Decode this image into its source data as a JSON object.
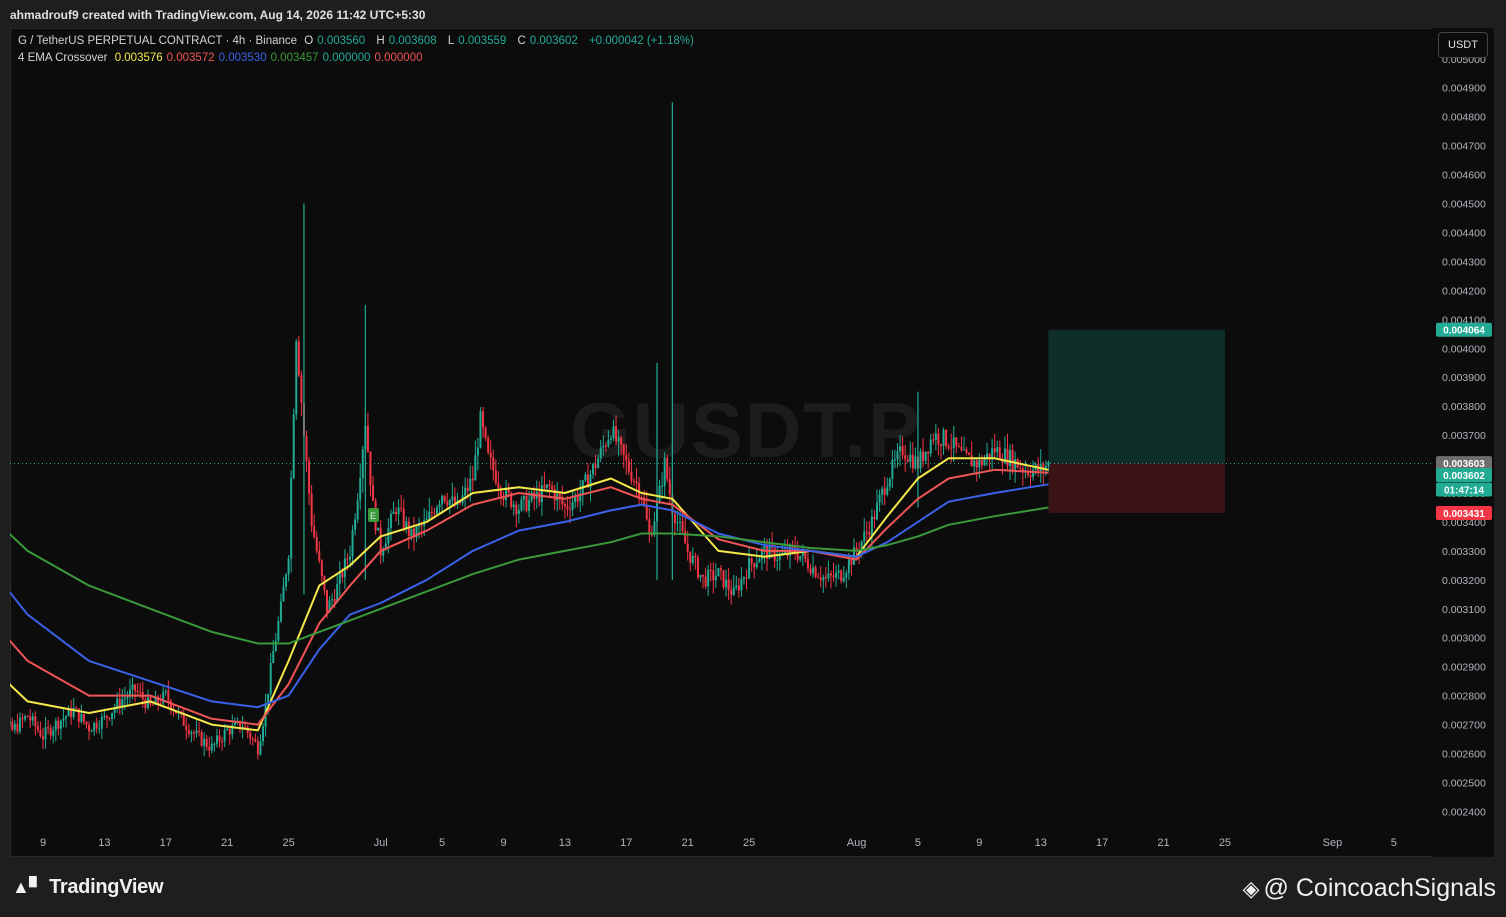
{
  "header": {
    "credit": "ahmadrouf9 created with TradingView.com, Aug 14, 2026 11:42 UTC+5:30"
  },
  "legend": {
    "symbol": "G / TetherUS PERPETUAL CONTRACT · 4h · Binance",
    "o_label": "O",
    "o": "0.003560",
    "h_label": "H",
    "h": "0.003608",
    "l_label": "L",
    "l": "0.003559",
    "c_label": "C",
    "c": "0.003602",
    "change": "+0.000042 (+1.18%)",
    "indicator": "4 EMA Crossover",
    "ema_values": [
      "0.003576",
      "0.003572",
      "0.003530",
      "0.003457",
      "0.000000",
      "0.000000"
    ],
    "ema_colors": [
      "#f5e94a",
      "#f05555",
      "#3a62e8",
      "#3a9a3a",
      "#22ab94",
      "#f05555"
    ]
  },
  "currency_button": "USDT",
  "watermark": "GUSDT.P",
  "footer": {
    "tv_logo": "TradingView",
    "brand": "@ CoincoachSignals"
  },
  "colors": {
    "up": "#22ab94",
    "down": "#f23645",
    "ema1": "#f5e94a",
    "ema2": "#f05555",
    "ema3": "#3a62e8",
    "ema4": "#3a9a3a",
    "target_zone": "#0f2e2a",
    "stop_zone": "#3a1414"
  },
  "chart_data": {
    "type": "candlestick",
    "timeframe": "4h",
    "x_ticks": [
      "9",
      "13",
      "17",
      "21",
      "25",
      "Jul",
      "5",
      "9",
      "13",
      "17",
      "21",
      "25",
      "Aug",
      "5",
      "9",
      "13",
      "17",
      "21",
      "25",
      "Sep",
      "5"
    ],
    "x_tick_days": [
      9,
      13,
      17,
      21,
      25,
      31,
      35,
      39,
      43,
      47,
      51,
      55,
      62,
      66,
      70,
      74,
      78,
      82,
      86,
      93,
      97
    ],
    "y_ticks": [
      "0.005000",
      "0.004900",
      "0.004800",
      "0.004700",
      "0.004600",
      "0.004500",
      "0.004400",
      "0.004300",
      "0.004200",
      "0.004100",
      "0.004000",
      "0.003900",
      "0.003800",
      "0.003700",
      "0.003600",
      "0.003500",
      "0.003400",
      "0.003300",
      "0.003200",
      "0.003100",
      "0.003000",
      "0.002900",
      "0.002800",
      "0.002700",
      "0.002600",
      "0.002500",
      "0.002400"
    ],
    "y_range": [
      0.00236,
      0.00502
    ],
    "price_close_path": [
      [
        5,
        0.0027
      ],
      [
        6,
        0.00272
      ],
      [
        7,
        0.00268
      ],
      [
        8,
        0.00273
      ],
      [
        9,
        0.00266
      ],
      [
        10,
        0.00271
      ],
      [
        11,
        0.00275
      ],
      [
        12,
        0.00269
      ],
      [
        13,
        0.00272
      ],
      [
        14,
        0.00278
      ],
      [
        15,
        0.00282
      ],
      [
        16,
        0.00276
      ],
      [
        17,
        0.0028
      ],
      [
        18,
        0.00272
      ],
      [
        19,
        0.00266
      ],
      [
        20,
        0.00262
      ],
      [
        21,
        0.00268
      ],
      [
        22,
        0.0027
      ],
      [
        23,
        0.00262
      ],
      [
        23.5,
        0.00276
      ],
      [
        24,
        0.00295
      ],
      [
        24.5,
        0.0031
      ],
      [
        25,
        0.0033
      ],
      [
        25.5,
        0.00405
      ],
      [
        26,
        0.0037
      ],
      [
        26.5,
        0.0034
      ],
      [
        27,
        0.00325
      ],
      [
        27.5,
        0.0031
      ],
      [
        28,
        0.00315
      ],
      [
        29,
        0.0033
      ],
      [
        29.5,
        0.0035
      ],
      [
        30,
        0.00375
      ],
      [
        30.5,
        0.00345
      ],
      [
        31,
        0.0033
      ],
      [
        32,
        0.00345
      ],
      [
        33,
        0.00335
      ],
      [
        34,
        0.0034
      ],
      [
        35,
        0.0035
      ],
      [
        36,
        0.00345
      ],
      [
        37,
        0.00355
      ],
      [
        37.5,
        0.00375
      ],
      [
        38,
        0.00362
      ],
      [
        39,
        0.0035
      ],
      [
        40,
        0.00345
      ],
      [
        41,
        0.00348
      ],
      [
        42,
        0.00352
      ],
      [
        43,
        0.00345
      ],
      [
        44,
        0.0035
      ],
      [
        45,
        0.0036
      ],
      [
        46,
        0.00372
      ],
      [
        47,
        0.0036
      ],
      [
        48,
        0.0035
      ],
      [
        48.5,
        0.00335
      ],
      [
        49,
        0.00345
      ],
      [
        49.5,
        0.0036
      ],
      [
        50,
        0.00345
      ],
      [
        51,
        0.0033
      ],
      [
        52,
        0.0032
      ],
      [
        53,
        0.00322
      ],
      [
        54,
        0.00315
      ],
      [
        55,
        0.00325
      ],
      [
        56,
        0.0033
      ],
      [
        57,
        0.00328
      ],
      [
        58,
        0.0033
      ],
      [
        59,
        0.00325
      ],
      [
        60,
        0.0032
      ],
      [
        61,
        0.00322
      ],
      [
        62,
        0.0033
      ],
      [
        63,
        0.0034
      ],
      [
        64,
        0.00355
      ],
      [
        65,
        0.00365
      ],
      [
        66,
        0.0036
      ],
      [
        67,
        0.0037
      ],
      [
        68,
        0.00368
      ],
      [
        69,
        0.00362
      ],
      [
        70,
        0.0036
      ],
      [
        71,
        0.00365
      ],
      [
        72,
        0.00362
      ],
      [
        73,
        0.00358
      ],
      [
        74,
        0.00358
      ],
      [
        74.5,
        0.0036
      ]
    ],
    "spikes": [
      [
        26,
        0.0045,
        0.00315
      ],
      [
        30,
        0.00415,
        0.0032
      ],
      [
        50,
        0.00485,
        0.0032
      ],
      [
        49,
        0.00395,
        0.0032
      ],
      [
        66,
        0.00385,
        0.00345
      ]
    ],
    "ema_lines": [
      {
        "color_key": "ema1",
        "points": [
          [
            5,
            0.00293
          ],
          [
            8,
            0.00278
          ],
          [
            12,
            0.00274
          ],
          [
            16,
            0.00278
          ],
          [
            20,
            0.0027
          ],
          [
            23,
            0.00268
          ],
          [
            25,
            0.00292
          ],
          [
            27,
            0.00318
          ],
          [
            29,
            0.00325
          ],
          [
            31,
            0.00335
          ],
          [
            34,
            0.0034
          ],
          [
            37,
            0.0035
          ],
          [
            40,
            0.00352
          ],
          [
            43,
            0.0035
          ],
          [
            46,
            0.00355
          ],
          [
            48,
            0.0035
          ],
          [
            50,
            0.00348
          ],
          [
            53,
            0.0033
          ],
          [
            56,
            0.00328
          ],
          [
            59,
            0.0033
          ],
          [
            62,
            0.00328
          ],
          [
            64,
            0.00342
          ],
          [
            66,
            0.00355
          ],
          [
            68,
            0.00362
          ],
          [
            71,
            0.00362
          ],
          [
            74.5,
            0.00358
          ]
        ]
      },
      {
        "color_key": "ema2",
        "points": [
          [
            5,
            0.0031
          ],
          [
            8,
            0.00292
          ],
          [
            12,
            0.0028
          ],
          [
            16,
            0.0028
          ],
          [
            20,
            0.00272
          ],
          [
            23,
            0.0027
          ],
          [
            25,
            0.00284
          ],
          [
            27,
            0.00305
          ],
          [
            29,
            0.00318
          ],
          [
            31,
            0.0033
          ],
          [
            34,
            0.00337
          ],
          [
            37,
            0.00346
          ],
          [
            40,
            0.0035
          ],
          [
            43,
            0.00348
          ],
          [
            46,
            0.00352
          ],
          [
            48,
            0.00348
          ],
          [
            50,
            0.00346
          ],
          [
            53,
            0.00334
          ],
          [
            56,
            0.0033
          ],
          [
            59,
            0.0033
          ],
          [
            62,
            0.00327
          ],
          [
            64,
            0.00338
          ],
          [
            66,
            0.00348
          ],
          [
            68,
            0.00355
          ],
          [
            71,
            0.00358
          ],
          [
            74.5,
            0.00357
          ]
        ]
      },
      {
        "color_key": "ema3",
        "points": [
          [
            5,
            0.00328
          ],
          [
            8,
            0.00308
          ],
          [
            12,
            0.00292
          ],
          [
            16,
            0.00285
          ],
          [
            20,
            0.00278
          ],
          [
            23,
            0.00276
          ],
          [
            25,
            0.0028
          ],
          [
            27,
            0.00296
          ],
          [
            29,
            0.00308
          ],
          [
            31,
            0.00312
          ],
          [
            34,
            0.0032
          ],
          [
            37,
            0.0033
          ],
          [
            40,
            0.00337
          ],
          [
            43,
            0.0034
          ],
          [
            46,
            0.00344
          ],
          [
            48,
            0.00346
          ],
          [
            50,
            0.00344
          ],
          [
            53,
            0.00336
          ],
          [
            56,
            0.00332
          ],
          [
            59,
            0.0033
          ],
          [
            62,
            0.00328
          ],
          [
            64,
            0.00333
          ],
          [
            66,
            0.0034
          ],
          [
            68,
            0.00347
          ],
          [
            71,
            0.0035
          ],
          [
            74.5,
            0.00353
          ]
        ]
      },
      {
        "color_key": "ema4",
        "points": [
          [
            5,
            0.00345
          ],
          [
            8,
            0.0033
          ],
          [
            12,
            0.00318
          ],
          [
            16,
            0.0031
          ],
          [
            20,
            0.00302
          ],
          [
            23,
            0.00298
          ],
          [
            25,
            0.00298
          ],
          [
            27,
            0.00302
          ],
          [
            29,
            0.00306
          ],
          [
            31,
            0.0031
          ],
          [
            34,
            0.00316
          ],
          [
            37,
            0.00322
          ],
          [
            40,
            0.00327
          ],
          [
            43,
            0.0033
          ],
          [
            46,
            0.00333
          ],
          [
            48,
            0.00336
          ],
          [
            50,
            0.00336
          ],
          [
            53,
            0.00335
          ],
          [
            56,
            0.00333
          ],
          [
            59,
            0.00331
          ],
          [
            62,
            0.0033
          ],
          [
            64,
            0.00332
          ],
          [
            66,
            0.00335
          ],
          [
            68,
            0.00339
          ],
          [
            71,
            0.00342
          ],
          [
            74.5,
            0.00345
          ]
        ]
      }
    ],
    "last_price": 0.003602,
    "entry_marker": {
      "day": 30.5,
      "price": 0.0034,
      "label": "E"
    },
    "position": {
      "start_day": 74.5,
      "end_day": 86,
      "entry": 0.003603,
      "target": 0.004064,
      "stop": 0.003431
    },
    "price_labels": [
      {
        "value": "0.004064",
        "price": 0.004064,
        "bg": "#22ab94"
      },
      {
        "value": "0.003603",
        "price": 0.003603,
        "bg": "#6e6e6e"
      },
      {
        "value": "0.003602",
        "price": 0.003562,
        "bg": "#22ab94"
      },
      {
        "value": "01:47:14",
        "price": 0.003512,
        "bg": "#22ab94"
      },
      {
        "value": "0.003431",
        "price": 0.003431,
        "bg": "#f23645"
      }
    ]
  }
}
